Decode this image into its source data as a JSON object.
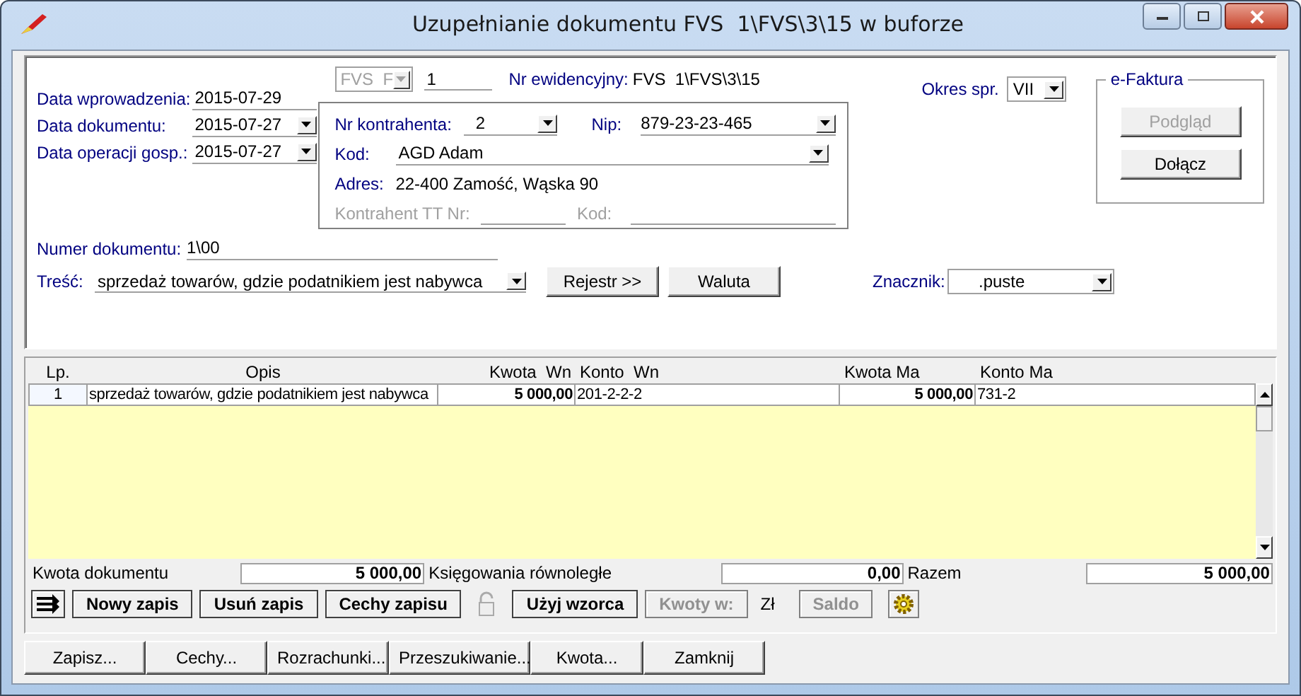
{
  "window": {
    "title": "Uzupełnianie dokumentu FVS  1\\FVS\\3\\15 w buforze"
  },
  "header": {
    "fields": [
      {
        "label": "Data wprowadzenia:",
        "value": "2015-07-29",
        "kind": "text"
      },
      {
        "label": "Data dokumentu:",
        "value": "2015-07-27",
        "kind": "dropdown"
      },
      {
        "label": "Data operacji gosp.:",
        "value": "2015-07-27",
        "kind": "dropdown"
      }
    ],
    "document_type": {
      "value": "FVS  F",
      "disabled": true
    },
    "number": "1",
    "registry_number": {
      "label": "Nr ewidencyjny:",
      "value": "FVS  1\\FVS\\3\\15"
    }
  },
  "contractor": {
    "number": {
      "label": "Nr kontrahenta:",
      "value": "2"
    },
    "nip": {
      "label": "Nip:",
      "value": "879-23-23-465"
    },
    "code": {
      "label": "Kod:",
      "value": "AGD Adam"
    },
    "address": {
      "label": "Adres:",
      "value": "22-400 Zamość, Wąska 90"
    },
    "tt_number": {
      "label": "Kontrahent TT Nr:",
      "disabled": true
    },
    "tt_code": {
      "label": "Kod:",
      "disabled": true
    }
  },
  "period": {
    "label": "Okres spr.",
    "value": "VII"
  },
  "e_invoice": {
    "title": "e-Faktura",
    "buttons": [
      {
        "label": "Podgląd",
        "disabled": true
      },
      {
        "label": "Dołącz",
        "disabled": false
      }
    ]
  },
  "document_number": {
    "label": "Numer dokumentu:",
    "value": "1\\00"
  },
  "content": {
    "label": "Treść:",
    "value": "sprzedaż towarów, gdzie podatnikiem jest nabywca"
  },
  "middle_buttons": [
    "Rejestr >>",
    "Waluta"
  ],
  "marker": {
    "label": "Znacznik:",
    "value": ".puste"
  },
  "table": {
    "columns": [
      "Lp.",
      "Opis",
      "Kwota  Wn",
      "Konto  Wn",
      "Kwota Ma",
      "Konto Ma"
    ],
    "rows": [
      [
        "1",
        "sprzedaż towarów, gdzie podatnikiem jest nabywca",
        "5 000,00",
        "201-2-2-2",
        "5 000,00",
        "731-2"
      ]
    ]
  },
  "totals": [
    {
      "label": "Kwota dokumentu",
      "value": "5 000,00"
    },
    {
      "label": "Księgowania równoległe",
      "value": "0,00"
    },
    {
      "label": "Razem",
      "value": "5 000,00"
    }
  ],
  "toolbar": [
    {
      "kind": "arrows"
    },
    {
      "kind": "button",
      "label": "Nowy zapis",
      "disabled": false
    },
    {
      "kind": "button",
      "label": "Usuń zapis",
      "disabled": false
    },
    {
      "kind": "button",
      "label": "Cechy zapisu",
      "disabled": false
    },
    {
      "kind": "lock"
    },
    {
      "kind": "button",
      "label": "Użyj wzorca",
      "disabled": false
    },
    {
      "kind": "button",
      "label": "Kwoty w:",
      "disabled": true
    },
    {
      "kind": "text",
      "label": "Zł"
    },
    {
      "kind": "button",
      "label": "Saldo",
      "disabled": true
    },
    {
      "kind": "gear"
    }
  ],
  "footer_buttons": [
    "Zapisz...",
    "Cechy...",
    "Rozrachunki...",
    "Przeszukiwanie...",
    "Kwota...",
    "Zamknij"
  ]
}
